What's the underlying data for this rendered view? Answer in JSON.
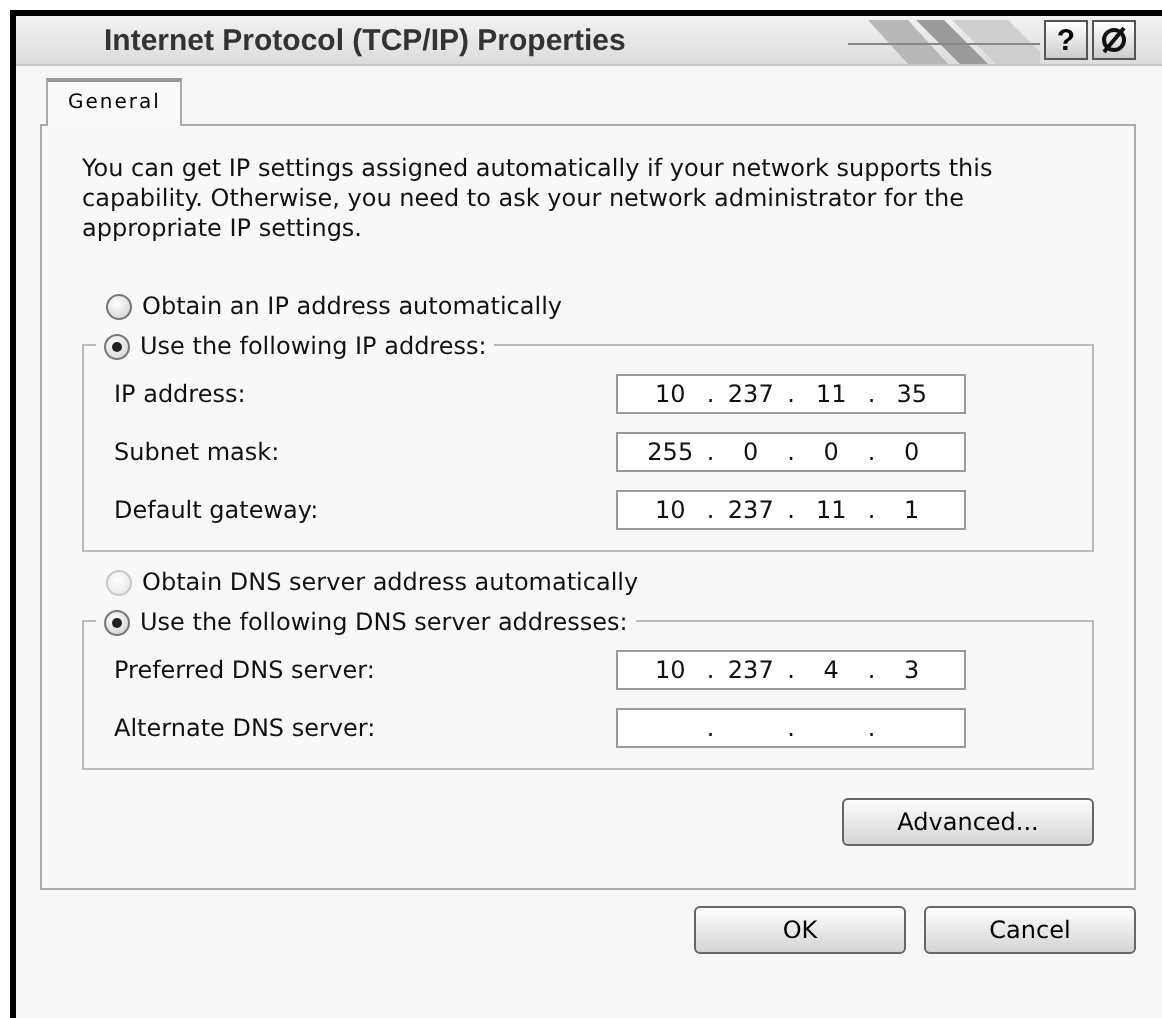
{
  "window": {
    "title": "Internet Protocol (TCP/IP) Properties",
    "help_button": "?"
  },
  "tabs": [
    {
      "label": "General",
      "selected": true
    }
  ],
  "description": "You can get IP settings assigned automatically if your network supports this capability. Otherwise, you need to ask your network administrator for the appropriate IP settings.",
  "sections": [
    {
      "auto_option": {
        "label": "Obtain an IP address automatically",
        "selected": false,
        "disabled": false
      },
      "manual_option": {
        "label": "Use the following IP address:",
        "selected": true
      },
      "fields": [
        {
          "label": "IP address:",
          "octets": [
            "10",
            "237",
            "11",
            "35"
          ]
        },
        {
          "label": "Subnet mask:",
          "octets": [
            "255",
            "0",
            "0",
            "0"
          ]
        },
        {
          "label": "Default gateway:",
          "octets": [
            "10",
            "237",
            "11",
            "1"
          ]
        }
      ]
    },
    {
      "auto_option": {
        "label": "Obtain DNS server address automatically",
        "selected": false,
        "disabled": true
      },
      "manual_option": {
        "label": "Use the following DNS server addresses:",
        "selected": true
      },
      "fields": [
        {
          "label": "Preferred DNS server:",
          "octets": [
            "10",
            "237",
            "4",
            "3"
          ]
        },
        {
          "label": "Alternate DNS server:"
        }
      ]
    }
  ],
  "octet_separator": ".",
  "advanced_button": "Advanced...",
  "buttons": [
    {
      "label": "OK"
    },
    {
      "label": "Cancel"
    }
  ]
}
